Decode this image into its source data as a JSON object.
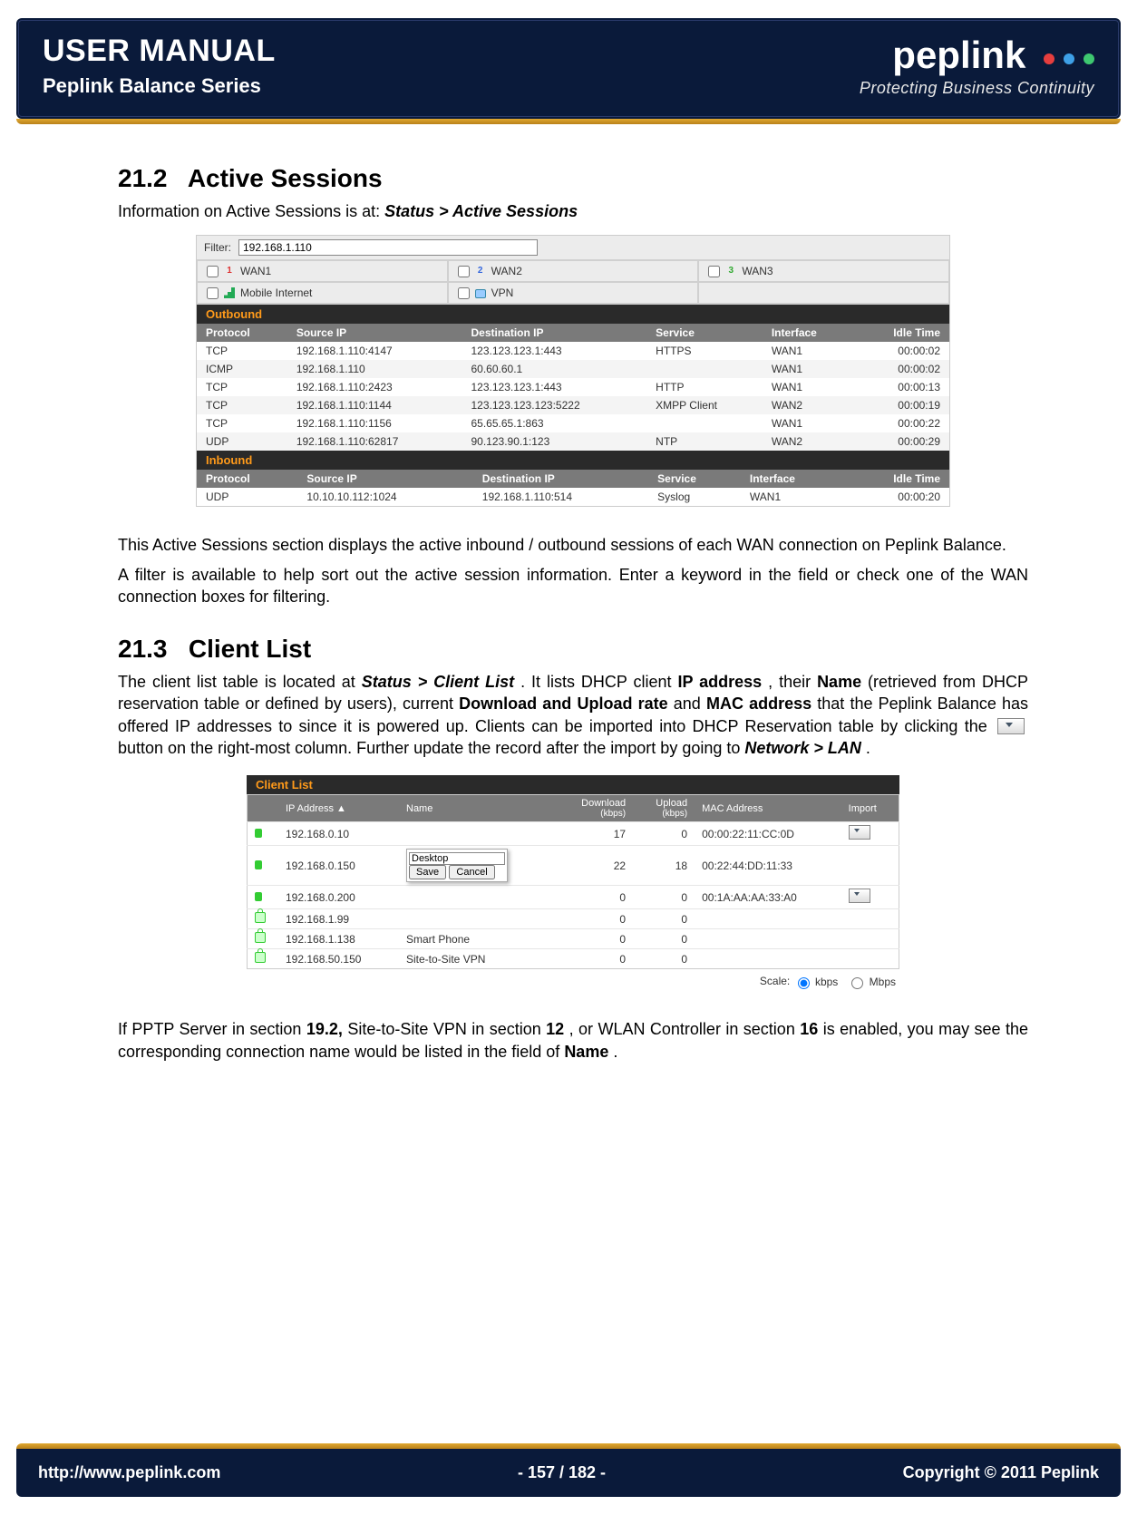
{
  "header": {
    "title1": "USER MANUAL",
    "title2": "Peplink Balance Series",
    "brand": "peplink",
    "tagline": "Protecting Business Continuity",
    "dot_colors": [
      "#e63e3e",
      "#3ea0e6",
      "#3ec870"
    ]
  },
  "section1": {
    "num": "21.2",
    "title": "Active Sessions",
    "intro_prefix": "Information on Active Sessions is at: ",
    "intro_path": "Status > Active Sessions",
    "para1": "This Active Sessions section displays the active inbound / outbound sessions of each WAN connection on Peplink Balance.",
    "para2": "A filter is available to help sort out the active session information. Enter a keyword in the field or check one of the WAN connection boxes for filtering."
  },
  "sessions": {
    "filter_label": "Filter:",
    "filter_value": "192.168.1.110",
    "wans": [
      {
        "num": "1",
        "label": "WAN1",
        "color": "#d33"
      },
      {
        "num": "2",
        "label": "WAN2",
        "color": "#36d"
      },
      {
        "num": "3",
        "label": "WAN3",
        "color": "#3a3"
      },
      {
        "num": "",
        "label": "Mobile Internet",
        "icon": "signal"
      },
      {
        "num": "",
        "label": "VPN",
        "icon": "lock"
      }
    ],
    "columns": [
      "Protocol",
      "Source IP",
      "Destination IP",
      "Service",
      "Interface",
      "Idle Time"
    ],
    "outbound_label": "Outbound",
    "outbound": [
      [
        "TCP",
        "192.168.1.110:4147",
        "123.123.123.1:443",
        "HTTPS",
        "WAN1",
        "00:00:02"
      ],
      [
        "ICMP",
        "192.168.1.110",
        "60.60.60.1",
        "",
        "WAN1",
        "00:00:02"
      ],
      [
        "TCP",
        "192.168.1.110:2423",
        "123.123.123.1:443",
        "HTTP",
        "WAN1",
        "00:00:13"
      ],
      [
        "TCP",
        "192.168.1.110:1144",
        "123.123.123.123:5222",
        "XMPP Client",
        "WAN2",
        "00:00:19"
      ],
      [
        "TCP",
        "192.168.1.110:1156",
        "65.65.65.1:863",
        "",
        "WAN1",
        "00:00:22"
      ],
      [
        "UDP",
        "192.168.1.110:62817",
        "90.123.90.1:123",
        "NTP",
        "WAN2",
        "00:00:29"
      ]
    ],
    "inbound_label": "Inbound",
    "inbound": [
      [
        "UDP",
        "10.10.10.112:1024",
        "192.168.1.110:514",
        "Syslog",
        "WAN1",
        "00:00:20"
      ]
    ]
  },
  "section2": {
    "num": "21.3",
    "title": "Client List",
    "p1_a": "The client list table is located at ",
    "p1_path": "Status > Client List",
    "p1_b": ".  It lists DHCP client ",
    "p1_ip": "IP address",
    "p1_c": ", their ",
    "p1_name": "Name",
    "p1_d": " (retrieved from DHCP reservation table or defined by users), current ",
    "p1_rate": "Download and Upload rate",
    "p1_e": " and ",
    "p1_mac": "MAC address",
    "p1_f": " that the Peplink Balance has offered IP addresses to since it is powered up. Clients can be imported into DHCP Reservation table by clicking the ",
    "p1_g": " button on the right-most column. Further update the record after the import by going to ",
    "p1_net": "Network > LAN",
    "p1_h": ".",
    "para2_a": "If PPTP Server in section ",
    "para2_s1": "19.2,",
    "para2_b": " Site-to-Site VPN in section ",
    "para2_s2": "12",
    "para2_c": ", or WLAN Controller in section ",
    "para2_s3": "16",
    "para2_d": " is enabled, you may see the corresponding connection name would be listed in the field of ",
    "para2_name": "Name",
    "para2_e": "."
  },
  "client": {
    "title": "Client List",
    "headers": {
      "ip": "IP Address ▲",
      "name": "Name",
      "down": "Download",
      "down_unit": "(kbps)",
      "up": "Upload",
      "up_unit": "(kbps)",
      "mac": "MAC Address",
      "import": "Import"
    },
    "edit_value": "Desktop",
    "edit_save": "Save",
    "edit_cancel": "Cancel",
    "rows": [
      {
        "lock": false,
        "ip": "192.168.0.10",
        "name": "",
        "dl": "17",
        "ul": "0",
        "mac": "00:00:22:11:CC:0D",
        "import": true
      },
      {
        "lock": false,
        "ip": "192.168.0.150",
        "name": "__edit__",
        "dl": "22",
        "ul": "18",
        "mac": "00:22:44:DD:11:33",
        "import": false
      },
      {
        "lock": false,
        "ip": "192.168.0.200",
        "name": "",
        "dl": "0",
        "ul": "0",
        "mac": "00:1A:AA:AA:33:A0",
        "import": true
      },
      {
        "lock": true,
        "ip": "192.168.1.99",
        "name": "",
        "dl": "0",
        "ul": "0",
        "mac": "",
        "import": false
      },
      {
        "lock": true,
        "ip": "192.168.1.138",
        "name": "Smart Phone",
        "dl": "0",
        "ul": "0",
        "mac": "",
        "import": false
      },
      {
        "lock": true,
        "ip": "192.168.50.150",
        "name": "Site-to-Site VPN",
        "dl": "0",
        "ul": "0",
        "mac": "",
        "import": false
      }
    ],
    "scale_label": "Scale:",
    "scale_kbps": "kbps",
    "scale_mbps": "Mbps"
  },
  "footer": {
    "url": "http://www.peplink.com",
    "page": "- 157 / 182 -",
    "copy": "Copyright © 2011 Peplink"
  }
}
